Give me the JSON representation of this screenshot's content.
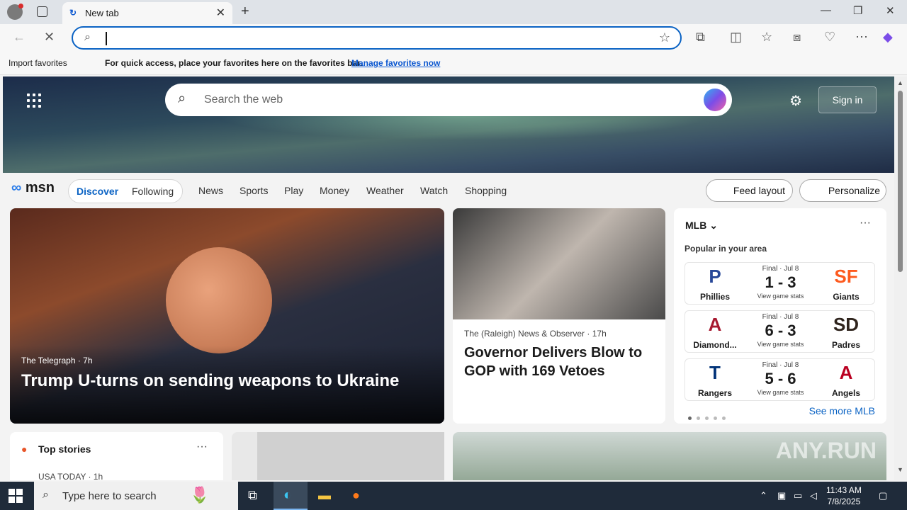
{
  "browser": {
    "tab_title": "New tab",
    "import_favorites": "Import favorites",
    "favbar_message": "For quick access, place your favorites here on the favorites bar.",
    "manage_favorites": "Manage favorites now",
    "window_controls": {
      "minimize": "—",
      "restore": "❐",
      "close": "✕"
    }
  },
  "msn": {
    "search_placeholder": "Search the web",
    "sign_in": "Sign in",
    "logo": "msn",
    "tabs": {
      "discover": "Discover",
      "following": "Following"
    },
    "nav": [
      "News",
      "Sports",
      "Play",
      "Money",
      "Weather",
      "Watch",
      "Shopping"
    ],
    "feed_layout": "Feed layout",
    "personalize": "Personalize"
  },
  "main_story": {
    "source": "The Telegraph",
    "age": "7h",
    "headline": "Trump U-turns on sending weapons to Ukraine"
  },
  "second_story": {
    "source": "The (Raleigh) News & Observer",
    "age": "17h",
    "headline": "Governor Delivers Blow to GOP with 169 Vetoes"
  },
  "mlb": {
    "title": "MLB",
    "subtitle": "Popular in your area",
    "see_more": "See more MLB",
    "games": [
      {
        "home": "Phillies",
        "away": "Giants",
        "status": "Final · Jul 8",
        "score": "1 - 3",
        "link": "View game stats",
        "home_color": "#284898",
        "away_color": "#fd5a1e",
        "home_logo": "P",
        "away_logo": "SF"
      },
      {
        "home": "Diamond...",
        "away": "Padres",
        "status": "Final · Jul 8",
        "score": "6 - 3",
        "link": "View game stats",
        "home_color": "#a71930",
        "away_color": "#2f241d",
        "home_logo": "A",
        "away_logo": "SD"
      },
      {
        "home": "Rangers",
        "away": "Angels",
        "status": "Final · Jul 8",
        "score": "5 - 6",
        "link": "View game stats",
        "home_color": "#003278",
        "away_color": "#ba0021",
        "home_logo": "T",
        "away_logo": "A"
      }
    ]
  },
  "top_stories": {
    "title": "Top stories",
    "source": "USA TODAY · 1h"
  },
  "watermark": "ANY.RUN",
  "taskbar": {
    "search_text": "Type here to search",
    "time": "11:43 AM",
    "date": "7/8/2025"
  }
}
